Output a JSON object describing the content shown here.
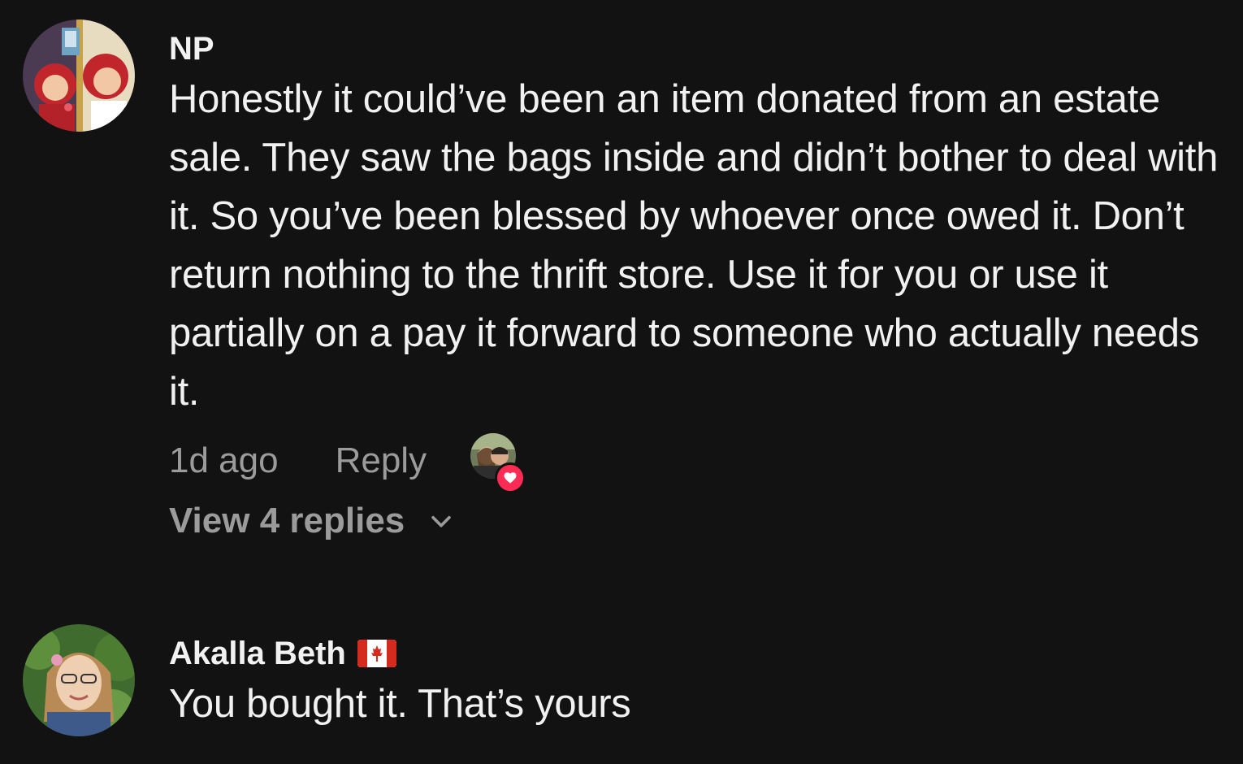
{
  "comments": [
    {
      "username": "NP",
      "text": "Honestly it could’ve been an item donated from an estate sale. They saw the bags inside and didn’t bother to deal with it. So you’ve been blessed by whoever once owed it. Don’t return nothing to the thrift store. Use it for you or use it partially on a pay it forward to someone who actually needs it.",
      "time": "1d ago",
      "reply_label": "Reply",
      "creator_liked": true,
      "view_replies_label": "View 4 replies",
      "avatar_icon": "avatar-illustration"
    },
    {
      "username": "Akalla Beth",
      "flag_icon": "canada-flag-icon",
      "text": "You bought it. That’s yours",
      "avatar_icon": "avatar-photo"
    }
  ],
  "colors": {
    "background": "#121212",
    "text": "#f1f1f1",
    "muted": "#9b9b9b",
    "like_badge": "#fe2c55"
  }
}
